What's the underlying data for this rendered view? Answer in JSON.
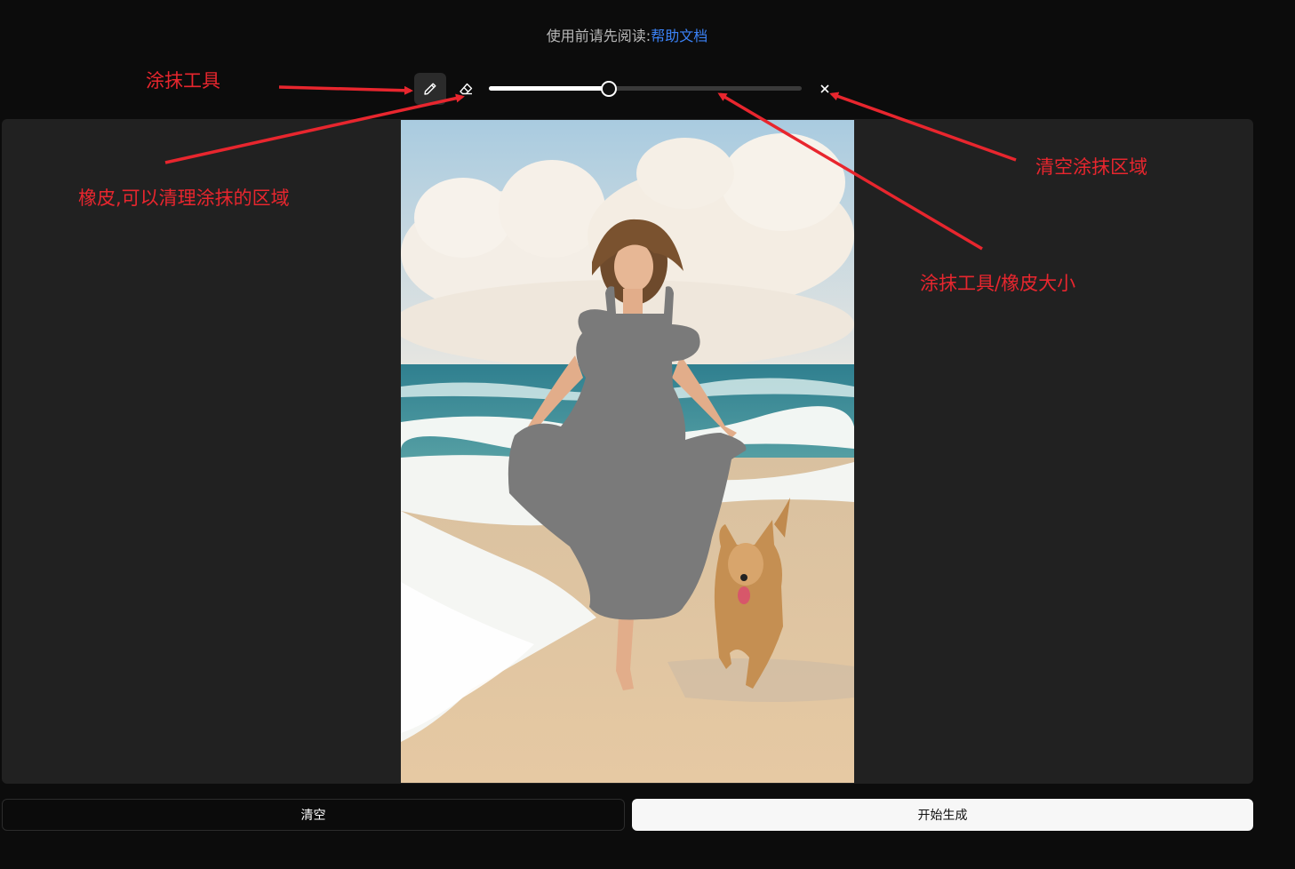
{
  "header": {
    "notice_text": "使用前请先阅读:",
    "help_link": "帮助文档"
  },
  "toolbar": {
    "brush_icon": "pencil-icon",
    "eraser_icon": "eraser-icon",
    "clear_icon": "close-icon",
    "brush_size_percent": 38
  },
  "actions": {
    "clear_label": "清空",
    "generate_label": "开始生成"
  },
  "annotations": {
    "brush": "涂抹工具",
    "eraser": "橡皮,可以清理涂抹的区域",
    "clear": "清空涂抹区域",
    "size": "涂抹工具/橡皮大小"
  },
  "colors": {
    "accent_link": "#3b82f6",
    "annotation_red": "#e8262e",
    "mask_gray": "#7a7a7a"
  }
}
